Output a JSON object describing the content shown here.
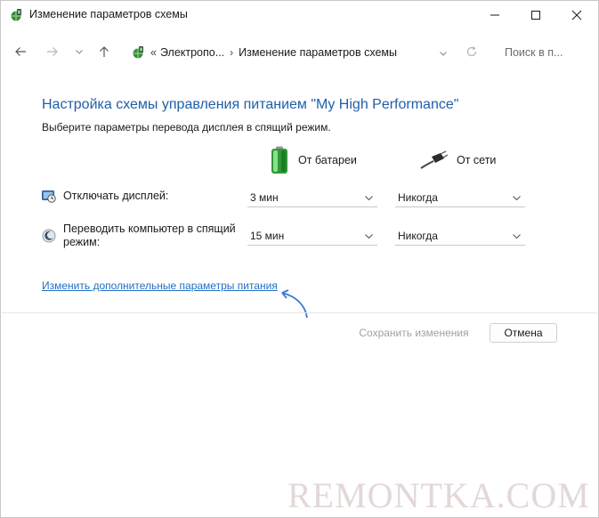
{
  "window": {
    "title": "Изменение параметров схемы"
  },
  "nav": {
    "breadcrumb_prefix": "«",
    "breadcrumb_parent": "Электропо...",
    "breadcrumb_current": "Изменение параметров схемы",
    "search_placeholder": "Поиск в п..."
  },
  "main": {
    "heading": "Настройка схемы управления питанием \"My High Performance\"",
    "subtitle": "Выберите параметры перевода дисплея в спящий режим.",
    "column_battery": "От батареи",
    "column_plugged": "От сети",
    "rows": [
      {
        "label": "Отключать дисплей:",
        "battery": "3 мин",
        "plugged": "Никогда"
      },
      {
        "label": "Переводить компьютер в спящий режим:",
        "battery": "15 мин",
        "plugged": "Никогда"
      }
    ],
    "advanced_link": "Изменить дополнительные параметры питания"
  },
  "footer": {
    "save_label": "Сохранить изменения",
    "cancel_label": "Отмена"
  },
  "watermark": "REMONTKA.COM",
  "colors": {
    "heading": "#1f5fa8",
    "link": "#1f6fc5",
    "arrow": "#3a7bd5",
    "battery": "#3cb043"
  }
}
